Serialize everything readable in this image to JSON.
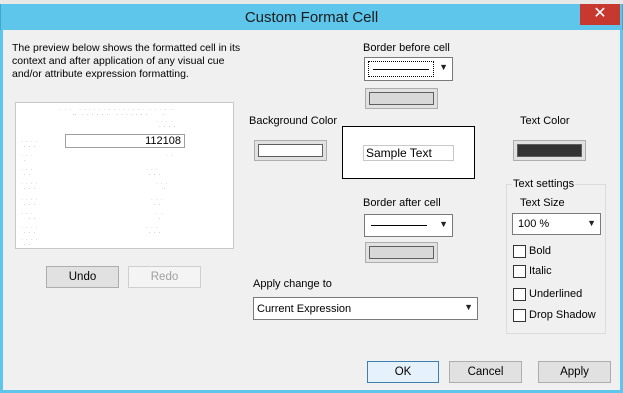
{
  "dialog": {
    "title": "Custom Format Cell",
    "close_label": "✕",
    "description": "The preview below shows the formatted cell in its context and after application of any visual cue and/or attribute expression formatting."
  },
  "preview": {
    "highlighted_value": "112108"
  },
  "history": {
    "undo_label": "Undo",
    "redo_label": "Redo"
  },
  "border_before": {
    "label": "Border before cell"
  },
  "border_after": {
    "label": "Border after cell"
  },
  "background": {
    "label": "Background Color",
    "color": "#ffffff"
  },
  "sample": {
    "text": "Sample Text"
  },
  "text_color": {
    "label": "Text Color",
    "color": "#333333"
  },
  "text_settings": {
    "group_label": "Text settings",
    "size_label": "Text Size",
    "size_value": "100 %",
    "bold_label": "Bold",
    "italic_label": "Italic",
    "underlined_label": "Underlined",
    "drop_shadow_label": "Drop Shadow"
  },
  "apply_change": {
    "label": "Apply change to",
    "value": "Current Expression"
  },
  "footer": {
    "ok_label": "OK",
    "cancel_label": "Cancel",
    "apply_label": "Apply"
  },
  "colors": {
    "title_bar": "#5ec6ea",
    "close_button": "#c7392f",
    "dialog_background": "#f0f0f0",
    "accent_border": "#3c7fb1"
  }
}
